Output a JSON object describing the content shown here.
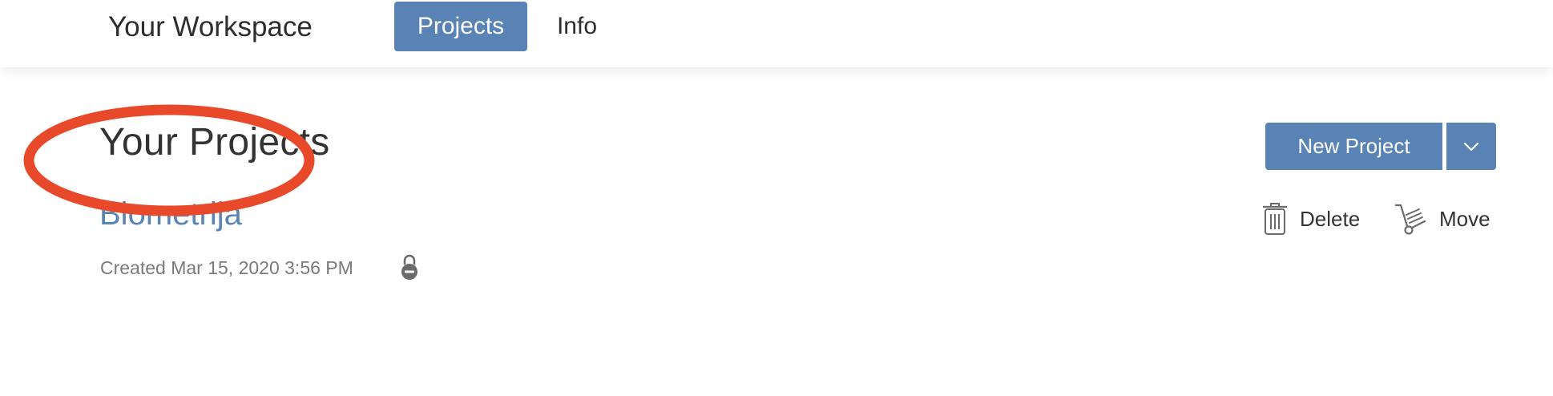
{
  "header": {
    "workspace_title": "Your Workspace",
    "tabs": [
      {
        "label": "Projects",
        "active": true
      },
      {
        "label": "Info",
        "active": false
      }
    ]
  },
  "main": {
    "page_title": "Your Projects",
    "new_project_label": "New Project",
    "dropdown_icon": "chevron-down-icon",
    "projects": [
      {
        "name": "Biometrija",
        "created": "Created Mar 15, 2020 3:56 PM",
        "status_icon": "lock-icon"
      }
    ],
    "actions": {
      "delete_label": "Delete",
      "delete_icon": "trash-icon",
      "move_label": "Move",
      "move_icon": "hand-truck-icon"
    }
  },
  "colors": {
    "accent": "#5a83b5",
    "annotation": "#e8492a",
    "meta_text": "#7a7a7a"
  }
}
